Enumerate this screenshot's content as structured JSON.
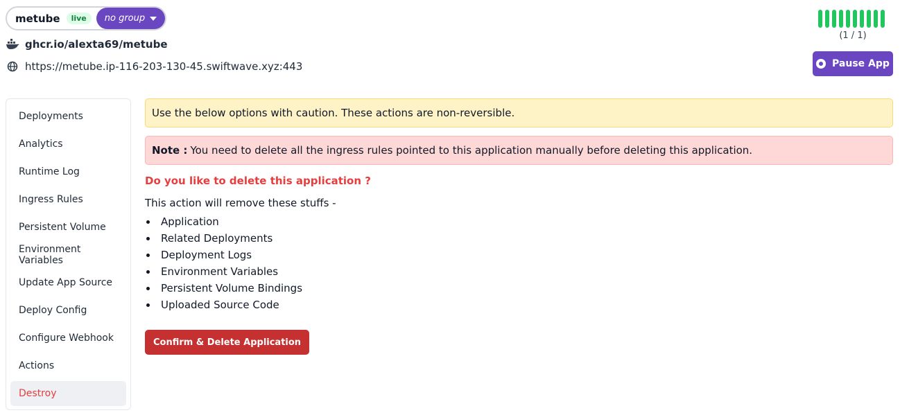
{
  "header": {
    "app_name": "metube",
    "status_badge": "live",
    "group_label": "no group",
    "image": "ghcr.io/alexta69/metube",
    "url": "https://metube.ip-116-203-130-45.swiftwave.xyz:443",
    "replica_count": "(1 / 1)",
    "pause_label": "Pause App"
  },
  "sidebar": {
    "items": [
      {
        "label": "Deployments"
      },
      {
        "label": "Analytics"
      },
      {
        "label": "Runtime Log"
      },
      {
        "label": "Ingress Rules"
      },
      {
        "label": "Persistent Volume"
      },
      {
        "label": "Environment Variables"
      },
      {
        "label": "Update App Source"
      },
      {
        "label": "Deploy Config"
      },
      {
        "label": "Configure Webhook"
      },
      {
        "label": "Actions"
      },
      {
        "label": "Destroy"
      }
    ],
    "active_index": 10
  },
  "main": {
    "caution_text": "Use the below options with caution. These actions are non-reversible.",
    "note_label": "Note :",
    "note_text": "You need to delete all the ingress rules pointed to this application manually before deleting this application.",
    "question": "Do you like to delete this application ?",
    "intro": "This action will remove these stuffs -",
    "items": [
      "Application",
      "Related Deployments",
      "Deployment Logs",
      "Environment Variables",
      "Persistent Volume Bindings",
      "Uploaded Source Code"
    ],
    "confirm_label": "Confirm & Delete Application"
  },
  "colors": {
    "accent": "#6b46c1",
    "danger": "#c53030",
    "replica_green": "#22c55e"
  },
  "icons": {
    "image": "docker-icon",
    "url": "globe-icon",
    "group_dropdown": "caret-down-icon",
    "pause": "pause-circle-icon"
  }
}
